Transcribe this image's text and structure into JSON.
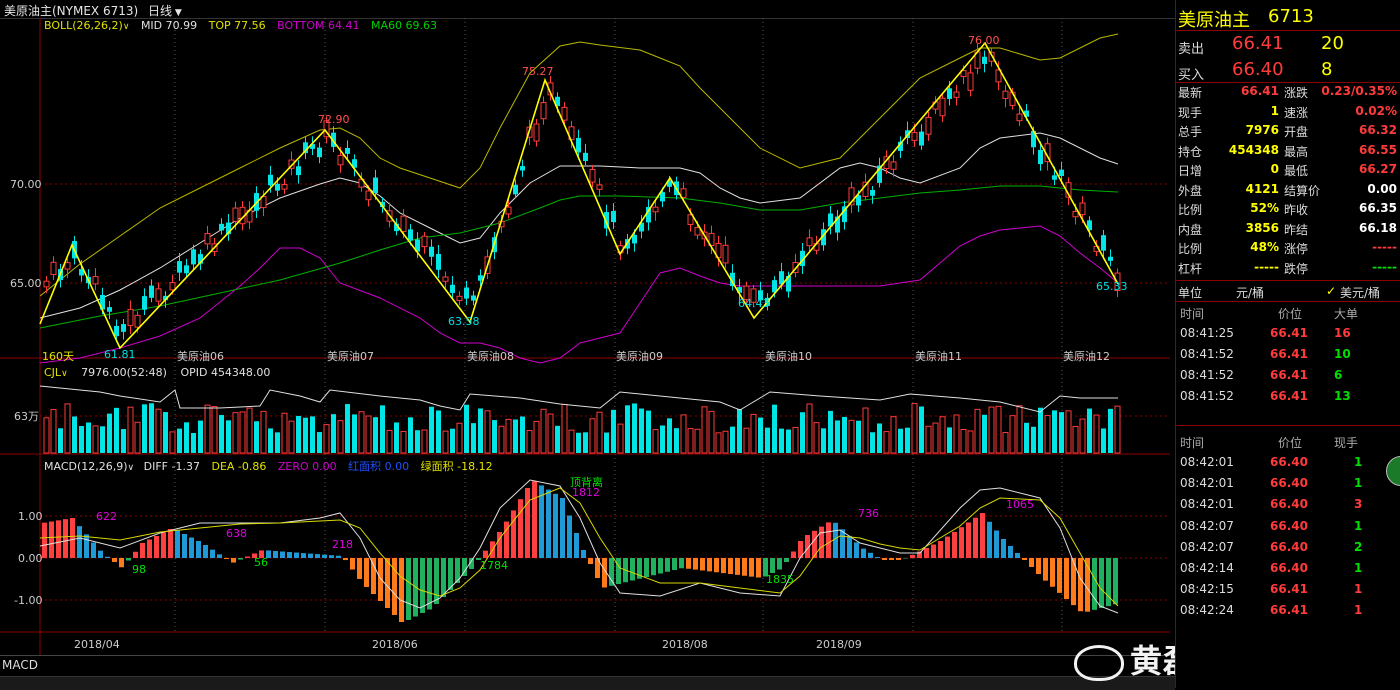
{
  "header": {
    "title": "美原油主(NYMEX 6713)",
    "period": "日线",
    "period_icon": "chevron-down-icon"
  },
  "main_chart": {
    "boll_label": "BOLL(26,26,2)",
    "mid": "MID 70.99",
    "top": "TOP 77.56",
    "bottom": "BOTTOM 64.41",
    "ma60": "MA60 69.63",
    "y_labels": [
      "70.00",
      "65.00"
    ],
    "days_label": "160天",
    "contract_labels": [
      "美原油06",
      "美原油07",
      "美原油08",
      "美原油09",
      "美原油10",
      "美原油11",
      "美原油12"
    ],
    "price_annotations": [
      "72.90",
      "75.27",
      "76.00",
      "61.81",
      "63.58",
      "64.43",
      "65.33"
    ]
  },
  "volume_chart": {
    "label": "CJL",
    "cjl": "7976.00(52:48)",
    "opid": "OPID 454348.00",
    "y_label": "63万"
  },
  "macd_chart": {
    "label": "MACD(12,26,9)",
    "diff": "DIFF -1.37",
    "dea": "DEA -0.86",
    "zero": "ZERO 0.00",
    "red_area": "红面积 0.00",
    "green_area": "绿面积 -18.12",
    "y_labels": [
      "1.00",
      "0.00",
      "-1.00"
    ],
    "annotations": [
      "622",
      "638",
      "218",
      "98",
      "56",
      "1784",
      "顶背离",
      "1812",
      "736",
      "1835",
      "1065"
    ],
    "x_labels": [
      "2018/04",
      "2018/06",
      "2018/08",
      "2018/09"
    ]
  },
  "bottom": {
    "tab": "MACD",
    "watermark": "黄磊的期货人生"
  },
  "quote": {
    "name": "美原油主",
    "code": "6713",
    "sell_label": "卖出",
    "sell_price": "66.41",
    "sell_qty": "20",
    "buy_label": "买入",
    "buy_price": "66.40",
    "buy_qty": "8",
    "rows": [
      {
        "l1": "最新",
        "v1": "66.41",
        "c1": "#ff3b3b",
        "l2": "涨跌",
        "v2": "0.23/0.35%",
        "c2": "#ff3b3b"
      },
      {
        "l1": "现手",
        "v1": "1",
        "c1": "#ffff00",
        "l2": "速涨",
        "v2": "0.02%",
        "c2": "#ff3b3b"
      },
      {
        "l1": "总手",
        "v1": "7976",
        "c1": "#ffff00",
        "l2": "开盘",
        "v2": "66.32",
        "c2": "#ff3b3b"
      },
      {
        "l1": "持仓",
        "v1": "454348",
        "c1": "#ffff00",
        "l2": "最高",
        "v2": "66.55",
        "c2": "#ff3b3b"
      },
      {
        "l1": "日增",
        "v1": "0",
        "c1": "#ffff00",
        "l2": "最低",
        "v2": "66.27",
        "c2": "#ff3b3b"
      },
      {
        "l1": "外盘",
        "v1": "4121",
        "c1": "#ffff00",
        "l2": "结算价",
        "v2": "0.00",
        "c2": "#ffffff"
      },
      {
        "l1": "比例",
        "v1": "52%",
        "c1": "#ffff00",
        "l2": "昨收",
        "v2": "66.35",
        "c2": "#ffffff"
      },
      {
        "l1": "内盘",
        "v1": "3856",
        "c1": "#ffff00",
        "l2": "昨结",
        "v2": "66.18",
        "c2": "#ffffff"
      },
      {
        "l1": "比例",
        "v1": "48%",
        "c1": "#ffff00",
        "l2": "涨停",
        "v2": "-----",
        "c2": "#ff3b3b"
      },
      {
        "l1": "杠杆",
        "v1": "-----",
        "c1": "#ffff00",
        "l2": "跌停",
        "v2": "-----",
        "c2": "#00e000"
      }
    ],
    "unit_label": "单位",
    "unit_value": "元/桶",
    "unit_check": "美元/桶",
    "ticks_header": {
      "time": "时间",
      "price": "价位",
      "size": "大单"
    },
    "big_ticks": [
      {
        "time": "08:41:25",
        "price": "66.41",
        "size": "16"
      },
      {
        "time": "08:41:52",
        "price": "66.41",
        "size": "10"
      },
      {
        "time": "08:41:52",
        "price": "66.41",
        "size": "6"
      },
      {
        "time": "08:41:52",
        "price": "66.41",
        "size": "13"
      }
    ],
    "ticks2_header": {
      "time": "时间",
      "price": "价位",
      "size": "现手"
    },
    "ticks": [
      {
        "time": "08:42:01",
        "price": "66.40",
        "size": "1",
        "color": "#00e000"
      },
      {
        "time": "08:42:01",
        "price": "66.40",
        "size": "1",
        "color": "#00e000"
      },
      {
        "time": "08:42:01",
        "price": "66.40",
        "size": "3",
        "color": "#ff3b3b"
      },
      {
        "time": "08:42:07",
        "price": "66.40",
        "size": "1",
        "color": "#00e000"
      },
      {
        "time": "08:42:07",
        "price": "66.40",
        "size": "2",
        "color": "#00e000"
      },
      {
        "time": "08:42:14",
        "price": "66.40",
        "size": "1",
        "color": "#00e000"
      },
      {
        "time": "08:42:15",
        "price": "66.41",
        "size": "1",
        "color": "#ff3b3b"
      },
      {
        "time": "08:42:24",
        "price": "66.41",
        "size": "1",
        "color": "#ff3b3b"
      }
    ]
  }
}
